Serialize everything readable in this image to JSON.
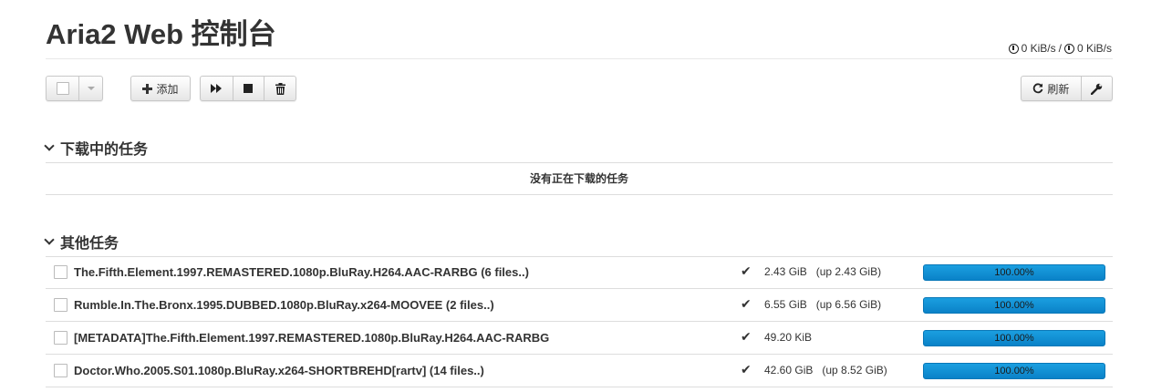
{
  "app": {
    "title": "Aria2 Web 控制台"
  },
  "speed": {
    "download": "0 KiB/s",
    "separator": "/",
    "upload": "0 KiB/s"
  },
  "toolbar": {
    "add_label": "添加",
    "refresh_label": "刷新"
  },
  "active": {
    "heading": "下载中的任务",
    "empty_message": "没有正在下载的任务"
  },
  "other": {
    "heading": "其他任务",
    "tasks": [
      {
        "name": "The.Fifth.Element.1997.REMASTERED.1080p.BluRay.H264.AAC-RARBG (6 files..)",
        "size": "2.43 GiB",
        "uploaded": "(up 2.43 GiB)",
        "progress_label": "100.00%",
        "progress": 1.0
      },
      {
        "name": "Rumble.In.The.Bronx.1995.DUBBED.1080p.BluRay.x264-MOOVEE (2 files..)",
        "size": "6.55 GiB",
        "uploaded": "(up 6.56 GiB)",
        "progress_label": "100.00%",
        "progress": 1.0
      },
      {
        "name": "[METADATA]The.Fifth.Element.1997.REMASTERED.1080p.BluRay.H264.AAC-RARBG",
        "size": "49.20 KiB",
        "uploaded": "",
        "progress_label": "100.00%",
        "progress": 1.0
      },
      {
        "name": "Doctor.Who.2005.S01.1080p.BluRay.x264-SHORTBREHD[rartv] (14 files..)",
        "size": "42.60 GiB",
        "uploaded": "(up 8.52 GiB)",
        "progress_label": "100.00%",
        "progress": 1.0
      }
    ]
  },
  "colors": {
    "progress_bar": "#0a8ad0",
    "text": "#333333"
  }
}
